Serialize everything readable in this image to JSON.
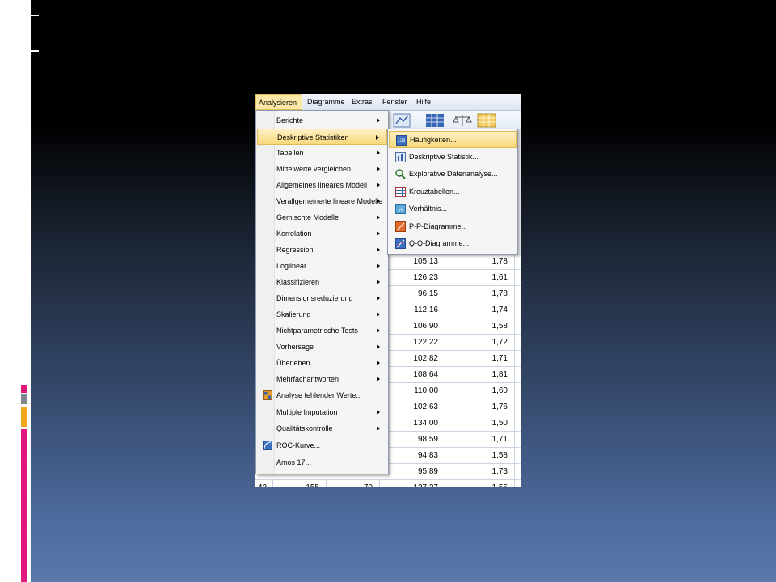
{
  "menubar": {
    "items": [
      "Analysieren",
      "Diagramme",
      "Extras",
      "Fenster",
      "Hilfe"
    ]
  },
  "analysieren_menu": {
    "items": [
      {
        "label": "Berichte",
        "submenu": true,
        "icon": ""
      },
      {
        "label": "Deskriptive Statistiken",
        "submenu": true,
        "icon": "",
        "highlighted": true
      },
      {
        "label": "Tabellen",
        "submenu": true,
        "icon": ""
      },
      {
        "label": "Mittelwerte vergleichen",
        "submenu": true,
        "icon": ""
      },
      {
        "label": "Allgemeines lineares Modell",
        "submenu": true,
        "icon": ""
      },
      {
        "label": "Verallgemeinerte lineare Modelle",
        "submenu": true,
        "icon": ""
      },
      {
        "label": "Gemischte Modelle",
        "submenu": true,
        "icon": ""
      },
      {
        "label": "Korrelation",
        "submenu": true,
        "icon": ""
      },
      {
        "label": "Regression",
        "submenu": true,
        "icon": ""
      },
      {
        "label": "Loglinear",
        "submenu": true,
        "icon": ""
      },
      {
        "label": "Klassifizieren",
        "submenu": true,
        "icon": ""
      },
      {
        "label": "Dimensionsreduzierung",
        "submenu": true,
        "icon": ""
      },
      {
        "label": "Skalierung",
        "submenu": true,
        "icon": ""
      },
      {
        "label": "Nichtparametrische Tests",
        "submenu": true,
        "icon": ""
      },
      {
        "label": "Vorhersage",
        "submenu": true,
        "icon": ""
      },
      {
        "label": "Überleben",
        "submenu": true,
        "icon": ""
      },
      {
        "label": "Mehrfachantworten",
        "submenu": true,
        "icon": ""
      },
      {
        "label": "Analyse fehlender Werte...",
        "submenu": false,
        "icon": "missing-values-icon"
      },
      {
        "label": "Multiple Imputation",
        "submenu": true,
        "icon": ""
      },
      {
        "label": "Qualitätskontrolle",
        "submenu": true,
        "icon": ""
      },
      {
        "label": "ROC-Kurve...",
        "submenu": false,
        "icon": "roc-curve-icon"
      },
      {
        "label": "Amos 17...",
        "submenu": false,
        "icon": ""
      }
    ]
  },
  "deskriptive_submenu": {
    "items": [
      {
        "label": "Häufigkeiten...",
        "icon": "frequencies-icon",
        "highlighted": true
      },
      {
        "label": "Deskriptive Statistik...",
        "icon": "descriptives-icon"
      },
      {
        "label": "Explorative Datenanalyse...",
        "icon": "explore-icon"
      },
      {
        "label": "Kreuztabellen...",
        "icon": "crosstabs-icon"
      },
      {
        "label": "Verhältnis...",
        "icon": "ratio-icon"
      },
      {
        "label": "P-P-Diagramme...",
        "icon": "pp-plot-icon"
      },
      {
        "label": "Q-Q-Diagramme...",
        "icon": "qq-plot-icon"
      }
    ]
  },
  "data_grid": {
    "rows": [
      [
        "105,13",
        "1,78"
      ],
      [
        "126,23",
        "1,61"
      ],
      [
        "96,15",
        "1,78"
      ],
      [
        "112,16",
        "1,74"
      ],
      [
        "106,90",
        "1,58"
      ],
      [
        "122,22",
        "1,72"
      ],
      [
        "102,82",
        "1,71"
      ],
      [
        "108,64",
        "1,81"
      ],
      [
        "110,00",
        "1,60"
      ],
      [
        "102,63",
        "1,76"
      ],
      [
        "134,00",
        "1,50"
      ],
      [
        "98,59",
        "1,71"
      ],
      [
        "94,83",
        "1,58"
      ],
      [
        "95,89",
        "1,73"
      ],
      [
        "127,27",
        "1,55"
      ]
    ],
    "last_row_prefix": [
      "43",
      "155",
      "70"
    ]
  },
  "colors": {
    "highlight": "#f8d97c",
    "menu_bg": "#f5f5f5",
    "deco_pink": "#e0187d",
    "deco_gray": "#808890",
    "deco_orange": "#f0a81e"
  }
}
